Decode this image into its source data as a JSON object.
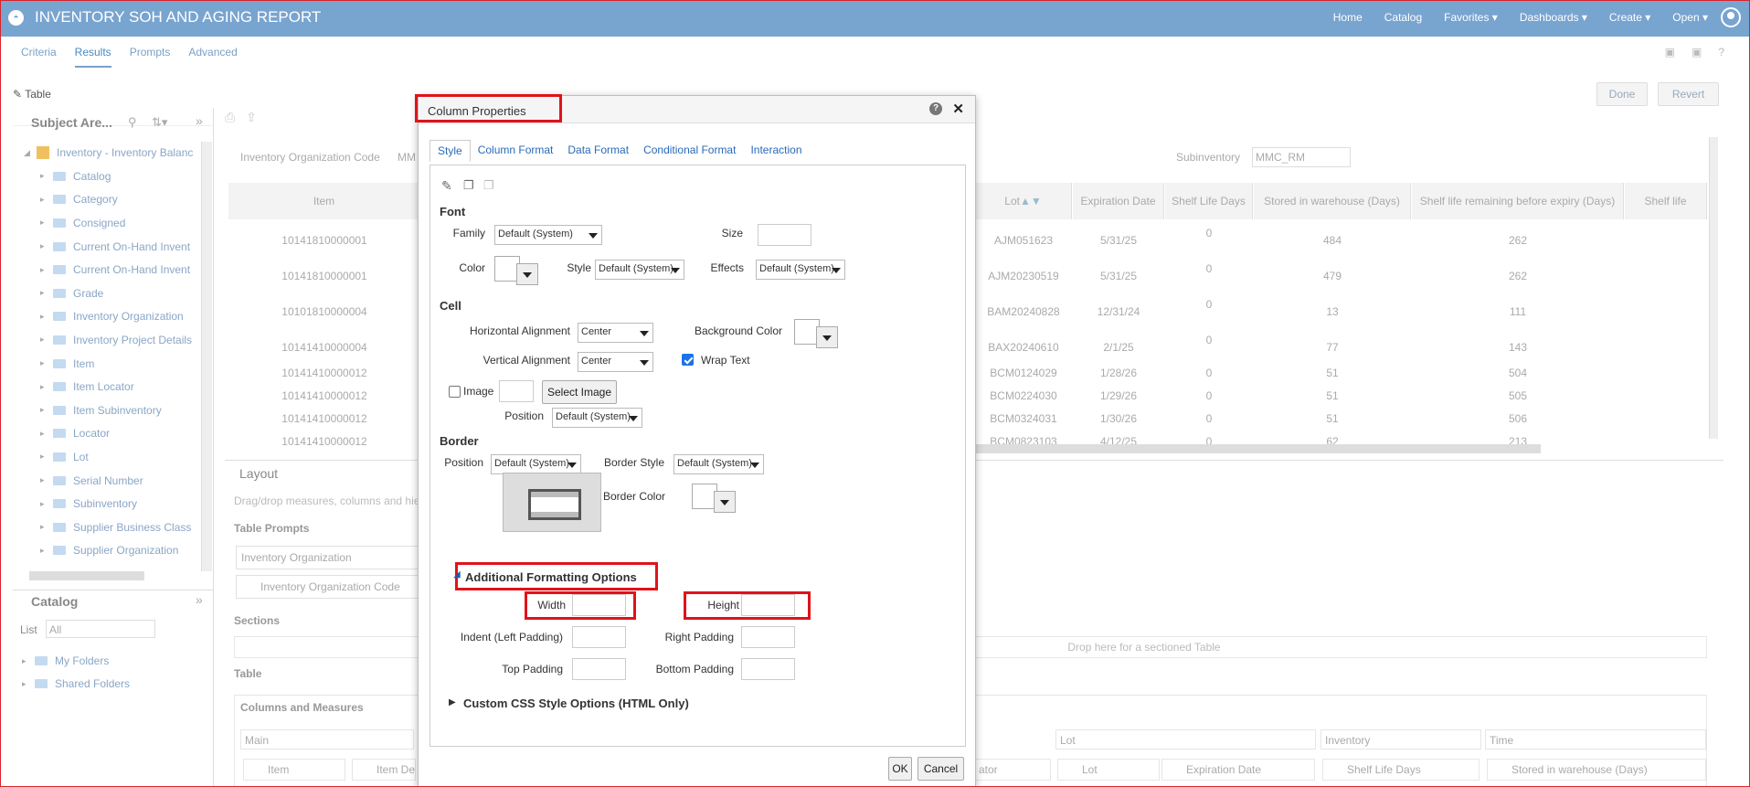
{
  "app": {
    "title": "INVENTORY SOH AND AGING REPORT"
  },
  "nav": [
    "Home",
    "Catalog",
    "Favorites ▾",
    "Dashboards ▾",
    "Create ▾",
    "Open ▾"
  ],
  "tabs": [
    "Criteria",
    "Results",
    "Prompts",
    "Advanced"
  ],
  "active_tab": "Results",
  "view_label": "Table",
  "done_label": "Done",
  "revert_label": "Revert",
  "subject_areas": {
    "header": "Subject Are...",
    "root": "Inventory - Inventory Balanc",
    "folders": [
      "Catalog",
      "Category",
      "Consigned",
      "Current On-Hand Invent",
      "Current On-Hand Invent",
      "Grade",
      "Inventory Organization",
      "Inventory Project Details",
      "Item",
      "Item Locator",
      "Item Subinventory",
      "Locator",
      "Lot",
      "Serial Number",
      "Subinventory",
      "Supplier Business Class",
      "Supplier Organization"
    ]
  },
  "catalog": {
    "header": "Catalog",
    "list_label": "List",
    "list_value": "All",
    "folders": [
      "My Folders",
      "Shared Folders"
    ]
  },
  "filters": {
    "inv_org_label": "Inventory Organization Code",
    "inv_org_value": "MM",
    "subinventory_label": "Subinventory",
    "subinventory_value": "MMC_RM"
  },
  "grid": {
    "headers": {
      "item": "Item",
      "lot": "Lot",
      "expiration": "Expiration Date",
      "shelf_life": "Shelf Life Days",
      "stored": "Stored in warehouse (Days)",
      "remaining": "Shelf life remaining before expiry (Days)",
      "shelf_life2": "Shelf life"
    },
    "rows": [
      {
        "item": "10141810000001",
        "lot": "AJM051623",
        "exp": "5/31/25",
        "shelf": "0",
        "stored": "484",
        "remaining": "262"
      },
      {
        "item": "10141810000001",
        "lot": "AJM20230519",
        "exp": "5/31/25",
        "shelf": "0",
        "stored": "479",
        "remaining": "262"
      },
      {
        "item": "10101810000004",
        "lot": "BAM20240828",
        "exp": "12/31/24",
        "shelf": "0",
        "stored": "13",
        "remaining": "111"
      },
      {
        "item": "10141410000004",
        "lot": "BAX20240610",
        "exp": "2/1/25",
        "shelf": "0",
        "stored": "77",
        "remaining": "143"
      },
      {
        "item": "10141410000012",
        "lot": "BCM0124029",
        "exp": "1/28/26",
        "shelf": "0",
        "stored": "51",
        "remaining": "504"
      },
      {
        "item": "10141410000012",
        "lot": "BCM0224030",
        "exp": "1/29/26",
        "shelf": "0",
        "stored": "51",
        "remaining": "505"
      },
      {
        "item": "10141410000012",
        "lot": "BCM0324031",
        "exp": "1/30/26",
        "shelf": "0",
        "stored": "51",
        "remaining": "506"
      },
      {
        "item": "10141410000012",
        "lot": "BCM0823103",
        "exp": "4/12/25",
        "shelf": "0",
        "stored": "62",
        "remaining": "213"
      }
    ]
  },
  "layout": {
    "title": "Layout",
    "hint": "Drag/drop measures, columns and hie",
    "table_prompts": "Table Prompts",
    "inv_org": "Inventory Organization",
    "inv_org_code": "Inventory Organization Code",
    "sections": "Sections",
    "drop_section": "Drop here for a sectioned Table",
    "table": "Table",
    "columns_measures": "Columns and Measures",
    "group_main": "Main",
    "group_lot": "Lot",
    "group_inventory": "Inventory",
    "group_time": "Time",
    "col_item": "Item",
    "col_itemdesc": "Item Des",
    "col_ator": "ator",
    "col_lot": "Lot",
    "col_exp": "Expiration Date",
    "col_shelf": "Shelf Life Days",
    "col_stored": "Stored in warehouse (Days)"
  },
  "dialog": {
    "title": "Column Properties",
    "tabs": [
      "Style",
      "Column Format",
      "Data Format",
      "Conditional Format",
      "Interaction"
    ],
    "font": {
      "section": "Font",
      "family_label": "Family",
      "family_value": "Default (System)",
      "size_label": "Size",
      "color_label": "Color",
      "style_label": "Style",
      "style_value": "Default (System)",
      "effects_label": "Effects",
      "effects_value": "Default (System)"
    },
    "cell": {
      "section": "Cell",
      "halign_label": "Horizontal Alignment",
      "halign_value": "Center",
      "bg_label": "Background Color",
      "valign_label": "Vertical Alignment",
      "valign_value": "Center",
      "wrap_label": "Wrap Text",
      "image_label": "Image",
      "select_image": "Select Image",
      "position_label": "Position",
      "position_value": "Default (System)"
    },
    "border": {
      "section": "Border",
      "position_label": "Position",
      "position_value": "Default (System)",
      "style_label": "Border Style",
      "style_value": "Default (System)",
      "color_label": "Border Color"
    },
    "additional": {
      "section": "Additional Formatting Options",
      "width_label": "Width",
      "height_label": "Height",
      "indent_label": "Indent (Left Padding)",
      "right_label": "Right Padding",
      "top_label": "Top Padding",
      "bottom_label": "Bottom Padding"
    },
    "custom_css": "Custom CSS Style Options (HTML Only)",
    "ok": "OK",
    "cancel": "Cancel"
  },
  "colors": {
    "header_bg": "#78a4d0",
    "highlight": "#e0121b",
    "link": "#2a6ab8"
  }
}
